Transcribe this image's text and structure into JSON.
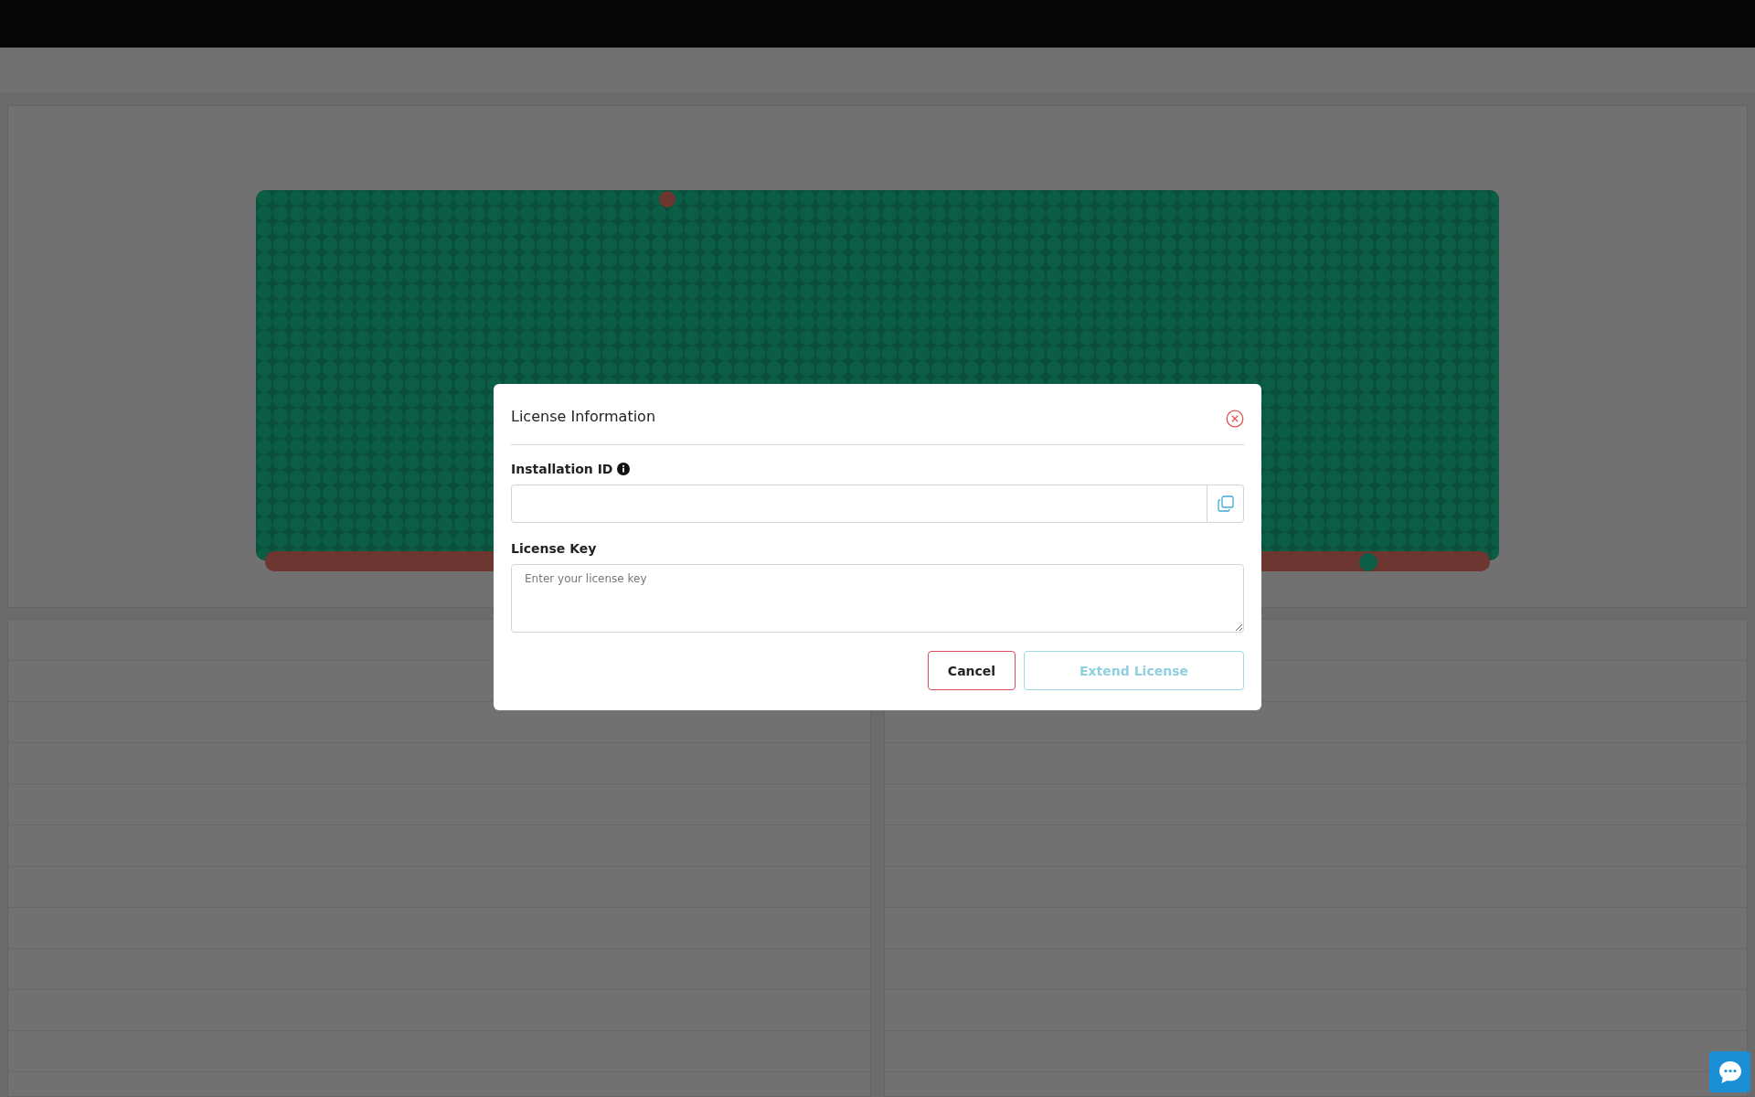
{
  "dialog": {
    "title": "License Information",
    "fields": [
      {
        "kind": "copy",
        "label": "Installation ID",
        "info": true
      },
      {
        "kind": "textarea",
        "label": "License Key",
        "placeholder": "Enter your license key"
      }
    ],
    "buttons": [
      {
        "kind": "cancel",
        "label": "Cancel",
        "disabled": false
      },
      {
        "kind": "primary",
        "label": "Extend License",
        "disabled": true
      }
    ]
  }
}
